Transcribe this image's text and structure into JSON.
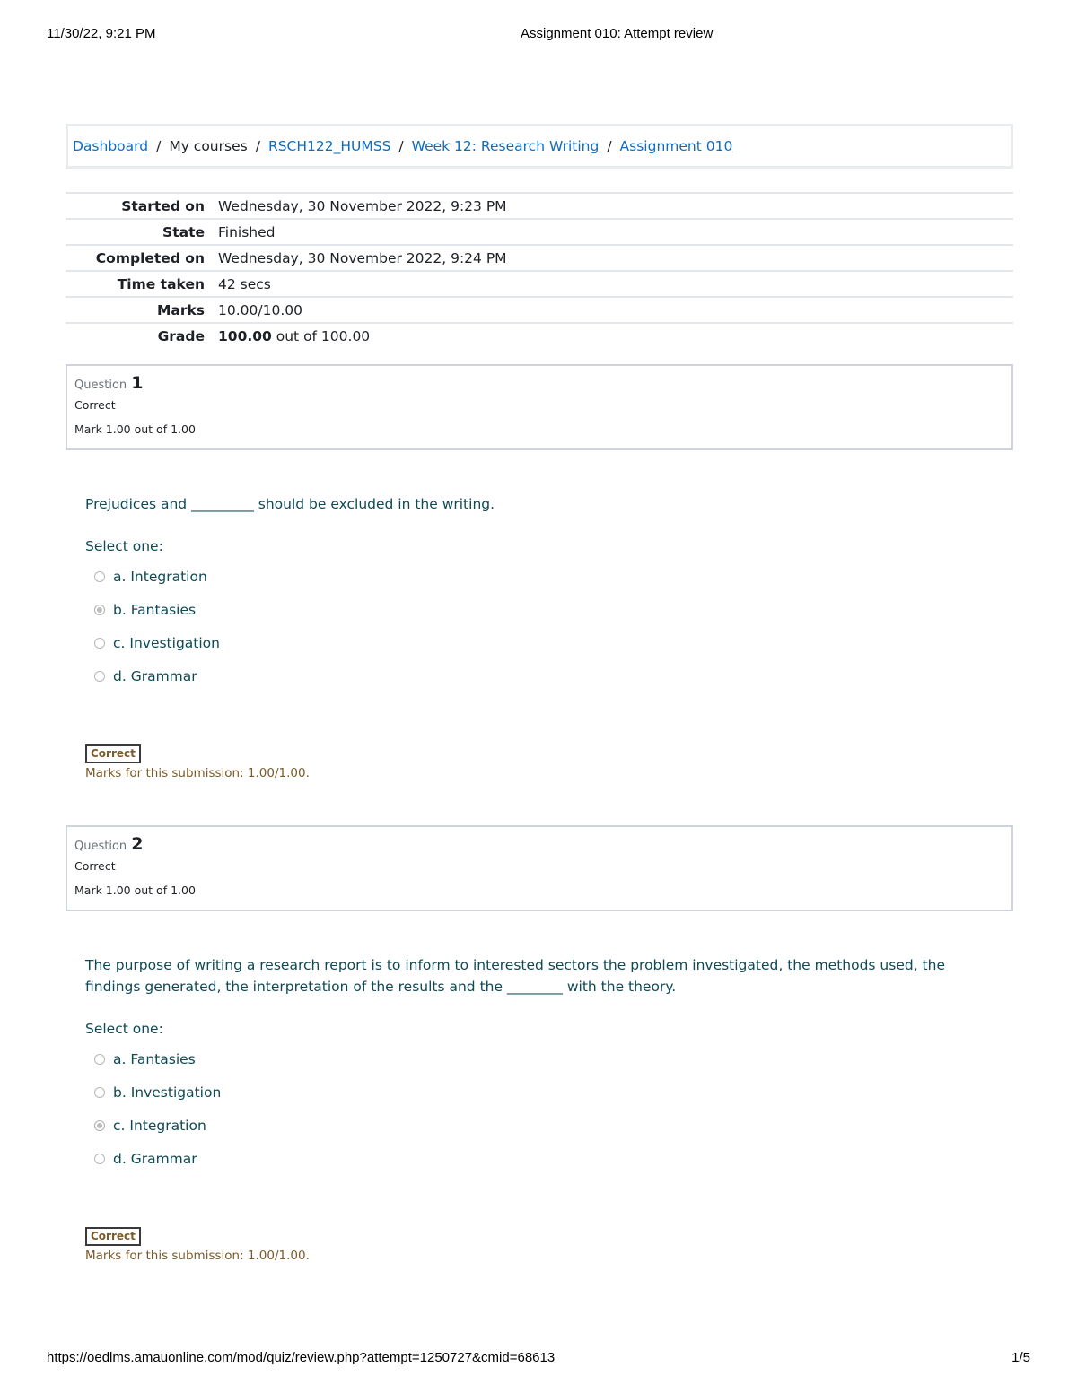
{
  "print": {
    "datetime": "11/30/22, 9:21 PM",
    "title": "Assignment 010: Attempt review",
    "url": "https://oedlms.amauonline.com/mod/quiz/review.php?attempt=1250727&cmid=68613",
    "page": "1/5"
  },
  "breadcrumb": {
    "items": [
      {
        "label": "Dashboard",
        "link": true
      },
      {
        "label": "My courses",
        "link": false
      },
      {
        "label": "RSCH122_HUMSS",
        "link": true
      },
      {
        "label": "Week 12: Research Writing",
        "link": true
      },
      {
        "label": "Assignment 010",
        "link": true
      }
    ],
    "separator": "/"
  },
  "summary": {
    "started_on": {
      "label": "Started on",
      "value": "Wednesday, 30 November 2022, 9:23 PM"
    },
    "state": {
      "label": "State",
      "value": "Finished"
    },
    "completed_on": {
      "label": "Completed on",
      "value": "Wednesday, 30 November 2022, 9:24 PM"
    },
    "time_taken": {
      "label": "Time taken",
      "value": "42 secs"
    },
    "marks": {
      "label": "Marks",
      "value": "10.00/10.00"
    },
    "grade": {
      "label": "Grade",
      "value_bold": "100.00",
      "value_rest": " out of 100.00"
    }
  },
  "questions": [
    {
      "label": "Question",
      "number": "1",
      "state": "Correct",
      "mark": "Mark 1.00 out of 1.00",
      "text": "Prejudices and _________ should be excluded in the writing.",
      "prompt": "Select one:",
      "options": [
        {
          "label": "a. Integration",
          "selected": false
        },
        {
          "label": "b. Fantasies",
          "selected": true
        },
        {
          "label": "c. Investigation",
          "selected": false
        },
        {
          "label": "d. Grammar",
          "selected": false
        }
      ],
      "feedback_badge": "Correct",
      "feedback_marks": "Marks for this submission: 1.00/1.00."
    },
    {
      "label": "Question",
      "number": "2",
      "state": "Correct",
      "mark": "Mark 1.00 out of 1.00",
      "text": "The purpose of writing a research report is to inform to interested sectors the problem investigated, the methods used, the findings generated, the interpretation of the results and the ________ with the theory.",
      "prompt": "Select one:",
      "options": [
        {
          "label": "a. Fantasies",
          "selected": false
        },
        {
          "label": "b. Investigation",
          "selected": false
        },
        {
          "label": "c. Integration",
          "selected": true
        },
        {
          "label": "d. Grammar",
          "selected": false
        }
      ],
      "feedback_badge": "Correct",
      "feedback_marks": "Marks for this submission: 1.00/1.00."
    }
  ]
}
